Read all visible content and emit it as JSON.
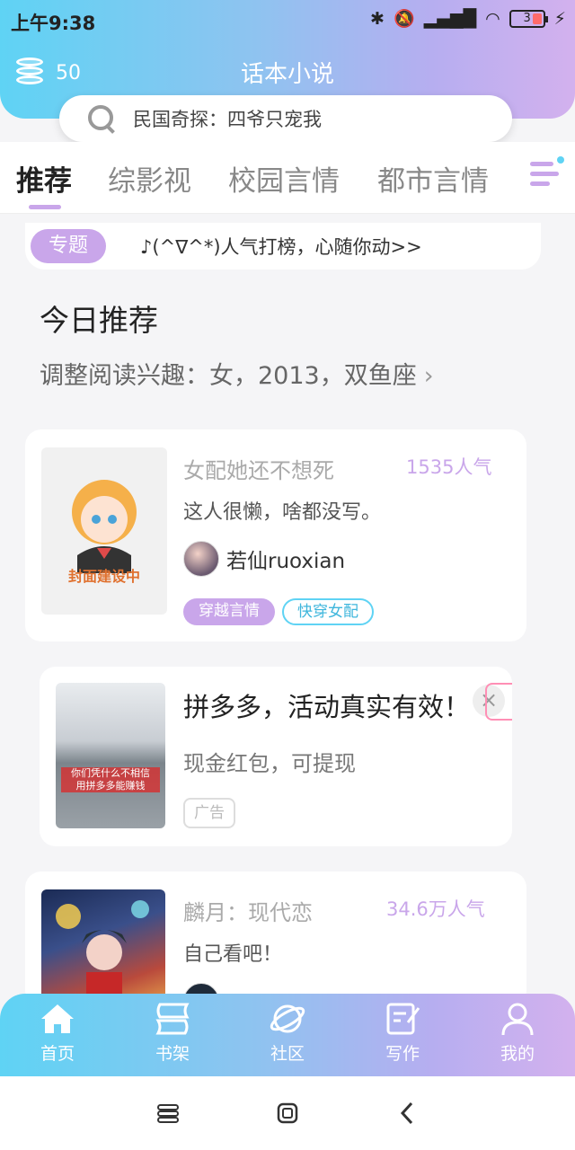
{
  "status": {
    "time": "上午9:38",
    "battery": "3"
  },
  "header": {
    "coin_count": "50",
    "app_title": "话本小说",
    "search_placeholder": "民国奇探：四爷只宠我"
  },
  "tabs": [
    {
      "label": "推荐",
      "active": true
    },
    {
      "label": "综影视"
    },
    {
      "label": "校园言情"
    },
    {
      "label": "都市言情"
    }
  ],
  "topic": {
    "badge": "专题",
    "text": "♪(^∇^*)人气打榜，心随你动>>"
  },
  "recommend": {
    "title": "今日推荐",
    "subtitle": "调整阅读兴趣：女，2013，双鱼座"
  },
  "cards": [
    {
      "title": "女配她还不想死",
      "popularity": "1535人气",
      "description": "这人很懒，啥都没写。",
      "author": "若仙ruoxian",
      "cover_text": "封面建设中",
      "tags": [
        "穿越言情",
        "快穿女配"
      ]
    },
    {
      "title": "麟月：现代恋",
      "popularity": "34.6万人气",
      "description": "自己看吧！"
    }
  ],
  "ad": {
    "title": "拼多多，活动真实有效！",
    "description": "现金红包，可提现",
    "badge": "广告",
    "close": "×",
    "image_caption": "你们凭什么不相信\n用拼多多能赚钱"
  },
  "bottom_nav": [
    {
      "label": "首页",
      "icon": "home-icon",
      "active": true
    },
    {
      "label": "书架",
      "icon": "bookshelf-icon"
    },
    {
      "label": "社区",
      "icon": "planet-icon"
    },
    {
      "label": "写作",
      "icon": "write-icon"
    },
    {
      "label": "我的",
      "icon": "user-icon"
    }
  ],
  "colors": {
    "accent_purple": "#c9a6ea",
    "accent_cyan": "#5fd3f4"
  }
}
